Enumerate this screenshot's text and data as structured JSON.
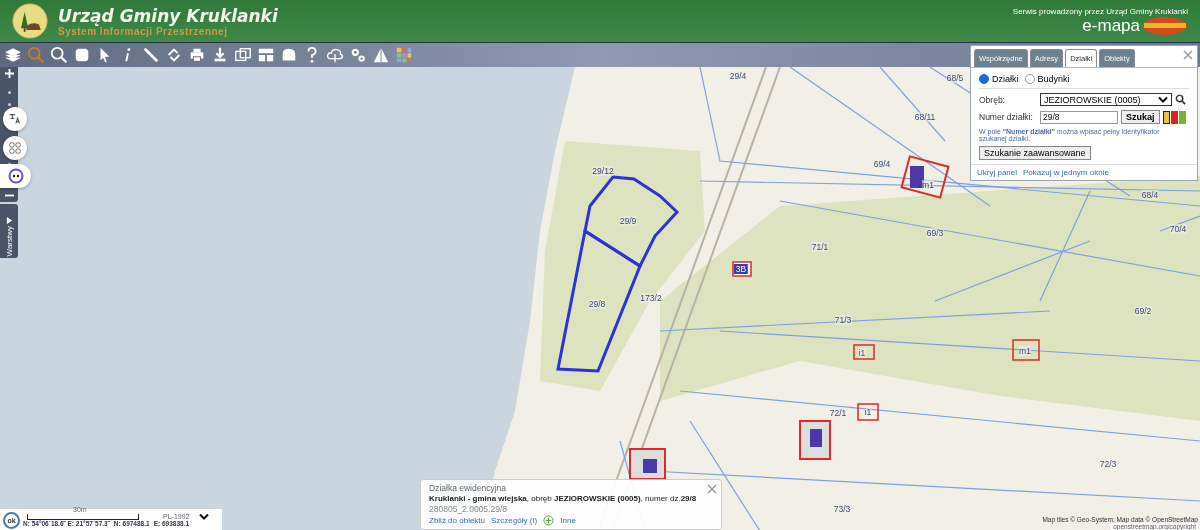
{
  "header": {
    "title": "Urząd Gminy Kruklanki",
    "subtitle": "System Informacji Przestrzennej",
    "service_note": "Serwis prowadzony przez Urząd Gminy Kruklanki",
    "brand": "e-mapa"
  },
  "left_panel": {
    "tab_label": "Warstwy"
  },
  "map_labels": [
    "29/4",
    "68/5",
    "68/11",
    "69/4",
    "68/4",
    "29/12",
    "29/9",
    "70/4",
    "69/3",
    "71/1",
    "3B",
    "29/8",
    "173/2",
    "71/3",
    "69/2",
    "72/1",
    "72/3",
    "73/3",
    "m1",
    "m1",
    "i1",
    "i1"
  ],
  "search_panel": {
    "tabs": [
      {
        "label": "Współrzędne",
        "selected": false
      },
      {
        "label": "Adresy",
        "selected": false
      },
      {
        "label": "Działki",
        "selected": true
      },
      {
        "label": "Obiekty",
        "selected": false
      }
    ],
    "modes": [
      {
        "label": "Działki",
        "selected": true
      },
      {
        "label": "Budynki",
        "selected": false
      }
    ],
    "precinct_label": "Obręb:",
    "precinct_value": "JEZIOROWSKIE (0005)",
    "number_label": "Numer działki:",
    "number_value": "29/8",
    "search_button": "Szukaj",
    "colors": [
      {
        "color": "#e8c440",
        "selected": true
      },
      {
        "color": "#e02020",
        "selected": false
      },
      {
        "color": "#7cb030",
        "selected": false
      }
    ],
    "hint": "W pole **\"Numer działki\"** można wpisać pełny identyfikator szukanej działki.",
    "advanced_button": "Szukanie zaawansowane",
    "links": [
      "Ukryj panel",
      "Pokazuj w jednym oknie"
    ]
  },
  "info_popup": {
    "title": "Działka ewidencyjna",
    "description": "**Kruklanki - gmina wiejska**, obręb **JEZIOROWSKIE (0005)**, numer dz.**29/8**",
    "identifier": "280805_2.0005.29/8",
    "links": [
      "Zbliż do obiektu",
      "Szczegóły (I)",
      "Inne"
    ]
  },
  "scale_bar": {
    "ok_label": "ok",
    "distance": "30m",
    "crs": "PL-1992",
    "geo_coords": "N: 54°06´18.6˝  E: 21°57´57.3˝",
    "north": "N: 697488.1",
    "east": "E: 693838.1"
  },
  "attribution": {
    "line_1": "Map tiles © Geo-System; Map data © OpenStreetMap",
    "line_2": "openstreetmap.org/copyright"
  }
}
